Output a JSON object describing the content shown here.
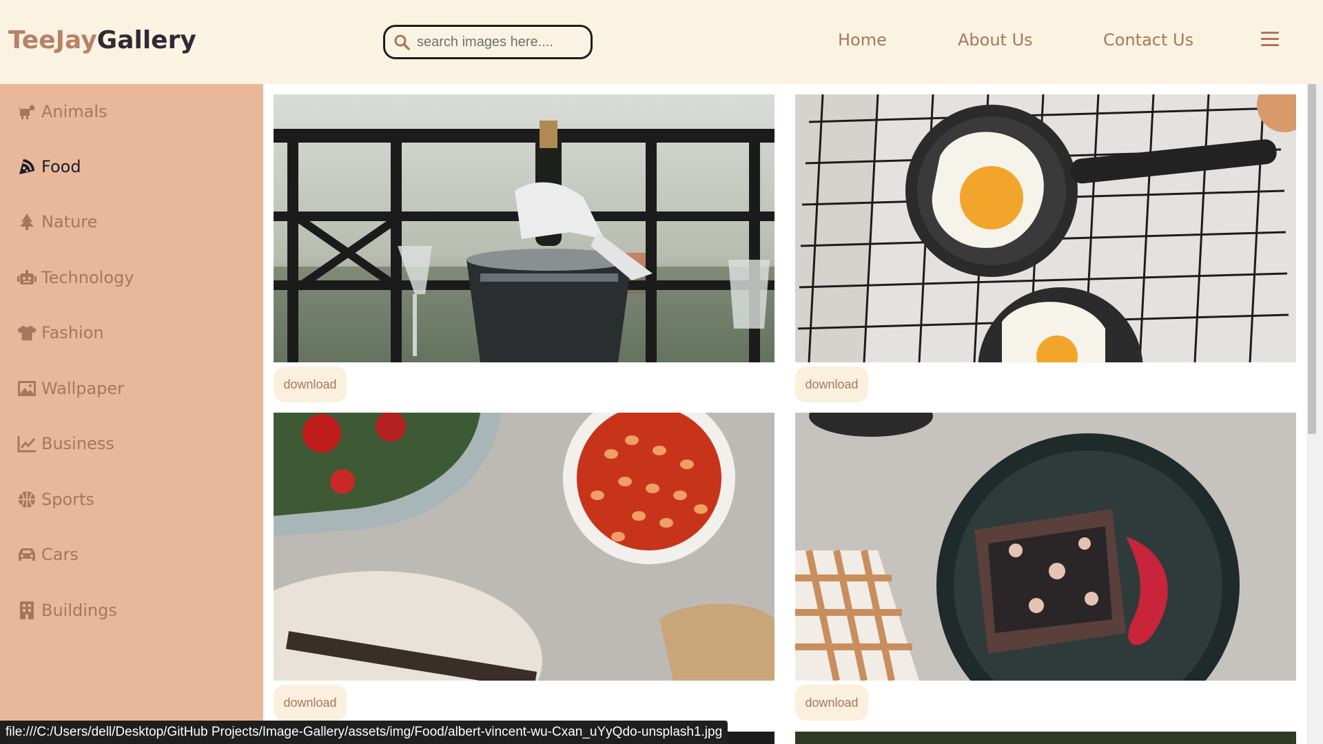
{
  "logo": {
    "part1": "TeeJay",
    "part2": "Gallery"
  },
  "search": {
    "placeholder": "search images here...."
  },
  "nav": {
    "home": "Home",
    "about": "About Us",
    "contact": "Contact Us"
  },
  "sidebar": {
    "items": [
      {
        "label": "Animals",
        "icon": "dog-icon",
        "active": false
      },
      {
        "label": "Food",
        "icon": "pizza-icon",
        "active": true
      },
      {
        "label": "Nature",
        "icon": "tree-icon",
        "active": false
      },
      {
        "label": "Technology",
        "icon": "robot-icon",
        "active": false
      },
      {
        "label": "Fashion",
        "icon": "shirt-icon",
        "active": false
      },
      {
        "label": "Wallpaper",
        "icon": "image-icon",
        "active": false
      },
      {
        "label": "Business",
        "icon": "chart-line-icon",
        "active": false
      },
      {
        "label": "Sports",
        "icon": "basketball-icon",
        "active": false
      },
      {
        "label": "Cars",
        "icon": "car-icon",
        "active": false
      },
      {
        "label": "Buildings",
        "icon": "building-icon",
        "active": false
      }
    ]
  },
  "gallery": {
    "download_label": "download",
    "images": [
      {
        "subject": "champagne-bucket"
      },
      {
        "subject": "fried-eggs-pans"
      },
      {
        "subject": "baked-beans-salad"
      },
      {
        "subject": "cake-on-plate"
      }
    ]
  },
  "status": {
    "url": "file:///C:/Users/dell/Desktop/GitHub Projects/Image-Gallery/assets/img/Food/albert-vincent-wu-Cxan_uYyQdo-unsplash1.jpg"
  },
  "colors": {
    "header_bg": "#fbf3e1",
    "sidebar_bg": "#e9b89a",
    "accent": "#a8765c",
    "active_text": "#1d1f2b",
    "button_bg": "#fbf0dd"
  }
}
